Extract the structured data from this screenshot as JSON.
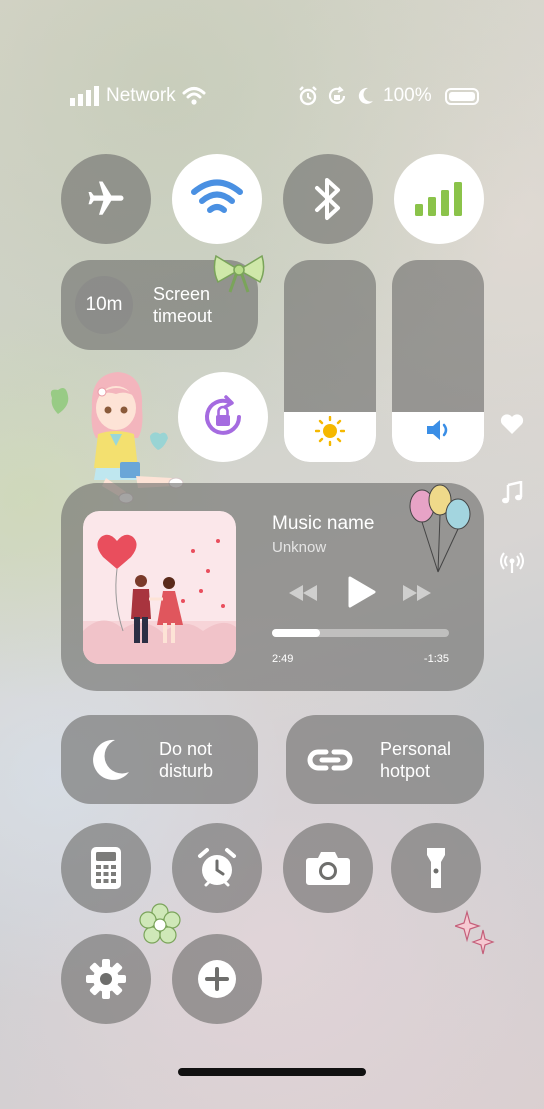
{
  "status_bar": {
    "carrier": "Network",
    "battery": "100%"
  },
  "tiles": {
    "screen_timeout": {
      "value": "10m",
      "label_line1": "Screen",
      "label_line2": "timeout"
    },
    "dnd": {
      "line1": "Do not",
      "line2": "disturb"
    },
    "hotspot": {
      "line1": "Personal",
      "line2": "hotpot"
    }
  },
  "media": {
    "title": "Music name",
    "artist": "Unknow",
    "elapsed": "2:49",
    "remaining": "-1:35",
    "progress": 0.27
  },
  "sliders": {
    "brightness_level": 0.25,
    "volume_level": 0.25
  },
  "colors": {
    "wifi_blue": "#4a90e2",
    "signal_green": "#8bc34a",
    "rotation_purple": "#a56be0",
    "sun_yellow": "#f5b800",
    "speaker_blue": "#3a8ee6"
  },
  "icons": [
    "signal-icon",
    "wifi-icon",
    "alarm-icon",
    "rotation-lock-icon",
    "moon-icon",
    "battery-icon",
    "airplane-icon",
    "bluetooth-icon",
    "cellular-icon",
    "sun-icon",
    "speaker-icon",
    "heart-icon",
    "music-note-icon",
    "broadcast-icon",
    "calculator-icon",
    "clock-icon",
    "camera-icon",
    "flashlight-icon",
    "settings-icon",
    "plus-icon",
    "link-icon"
  ]
}
